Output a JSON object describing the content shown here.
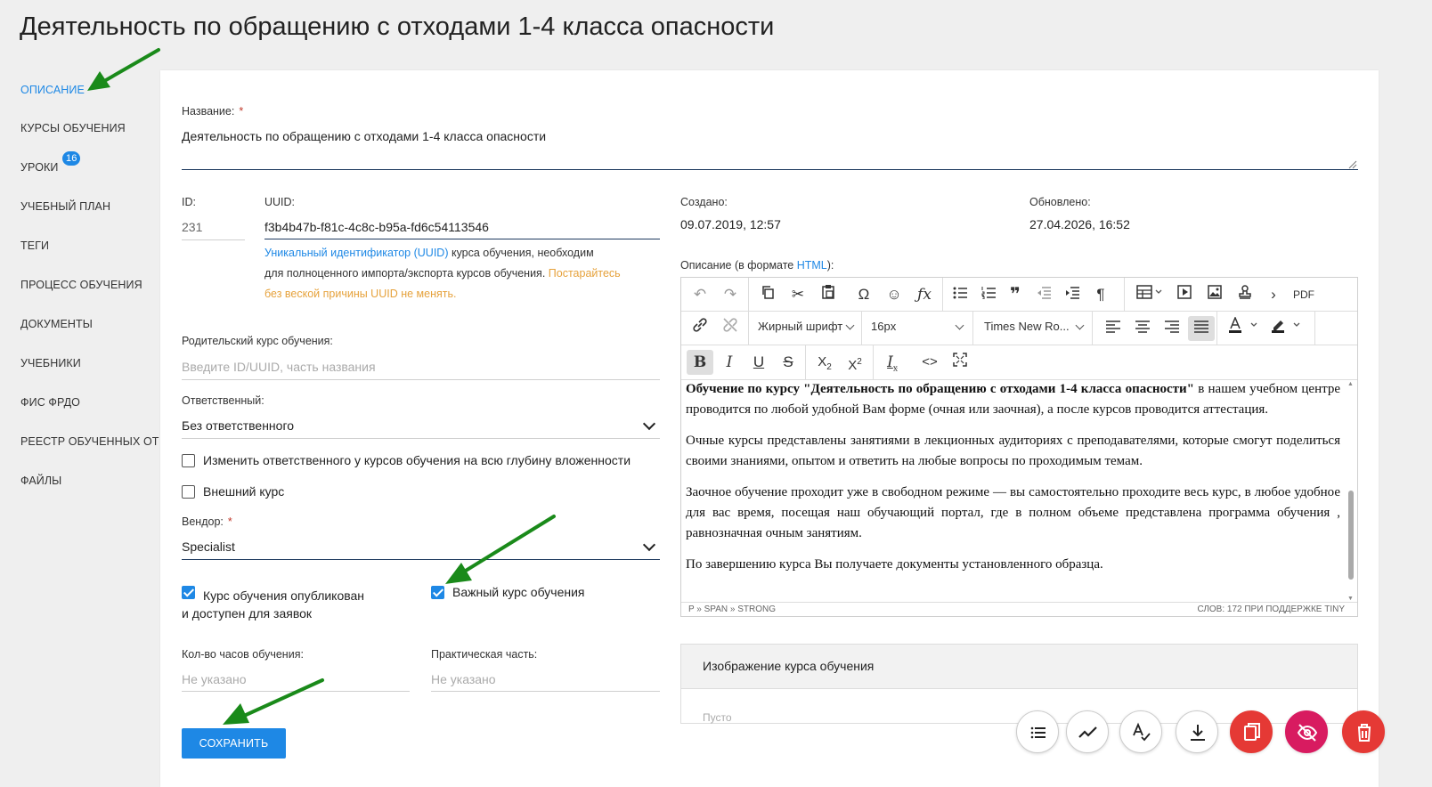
{
  "page": {
    "title": "Деятельность по обращению с отходами 1-4 класса опасности"
  },
  "sidebar": {
    "items": [
      {
        "label": "ОПИСАНИЕ",
        "active": true
      },
      {
        "label": "КУРСЫ ОБУЧЕНИЯ"
      },
      {
        "label": "УРОКИ",
        "badge": "16"
      },
      {
        "label": "УЧЕБНЫЙ ПЛАН"
      },
      {
        "label": "ТЕГИ"
      },
      {
        "label": "ПРОЦЕСС ОБУЧЕНИЯ"
      },
      {
        "label": "ДОКУМЕНТЫ"
      },
      {
        "label": "УЧЕБНИКИ"
      },
      {
        "label": "ФИС ФРДО"
      },
      {
        "label": "РЕЕСТР ОБУЧЕННЫХ ОТ"
      },
      {
        "label": "ФАЙЛЫ"
      }
    ]
  },
  "form": {
    "name": {
      "label": "Название:",
      "required": "*",
      "value": "Деятельность по обращению с отходами 1-4 класса опасности"
    },
    "id": {
      "label": "ID:",
      "value": "231"
    },
    "uuid": {
      "label": "UUID:",
      "value": "f3b4b47b-f81c-4c8c-b95a-fd6c54113546",
      "hint_link": "Уникальный идентификатор (UUID)",
      "hint_text1": " курса обучения, необходим",
      "hint_text2": "для полноценного импорта/экспорта курсов обучения. ",
      "hint_warn1": "Постарайтесь",
      "hint_warn2": "без веской причины UUID не менять."
    },
    "created": {
      "label": "Создано:",
      "value": "09.07.2019, 12:57"
    },
    "updated": {
      "label": "Обновлено:",
      "value": "27.04.2026, 16:52"
    },
    "parent": {
      "label": "Родительский курс обучения:",
      "placeholder": "Введите ID/UUID, часть названия"
    },
    "responsible": {
      "label": "Ответственный:",
      "value": "Без ответственного"
    },
    "change_responsible": {
      "label": "Изменить ответственного у курсов обучения на всю глубину вложенности",
      "checked": false
    },
    "external": {
      "label": "Внешний курс",
      "checked": false
    },
    "vendor": {
      "label": "Вендор:",
      "required": "*",
      "value": "Specialist"
    },
    "published": {
      "label1": "Курс обучения опубликован",
      "label2": "и доступен для заявок",
      "checked": true
    },
    "important": {
      "label": "Важный курс обучения",
      "checked": true
    },
    "hours": {
      "label": "Кол-во часов обучения:",
      "placeholder": "Не указано"
    },
    "practice": {
      "label": "Практическая часть:",
      "placeholder": "Не указано"
    },
    "save": {
      "label": "СОХРАНИТЬ"
    }
  },
  "editor": {
    "label_prefix": "Описание (в формате ",
    "label_link": "HTML",
    "label_suffix": "):",
    "toolbar": {
      "pdf": "PDF",
      "font_weight": "Жирный шрифт",
      "font_size": "16px",
      "font_family": "Times New Ro..."
    },
    "content": {
      "p1_bold": "Обучение по курсу \"Деятельность по обращению с отходами 1-4 класса опасности\"",
      "p1_rest": " в нашем учебном центре проводится по любой удобной Вам форме (очная или заочная), а после курсов проводится аттестация.",
      "p2": "Очные курсы  представлены занятиями в лекционных аудиториях с преподавателями, которые смогут поделиться своими знаниями, опытом и ответить на любые вопросы по проходимым темам.",
      "p3": "Заочное обучение проходит уже в свободном режиме — вы самостоятельно проходите весь курс, в любое удобное для вас время, посещая наш обучающий портал, где в полном объеме представлена программа обучения , равнозначная очным занятиям.",
      "p4": "По завершению курса Вы получаете документы установленного образца."
    },
    "status_path": "P » SPAN » STRONG",
    "status_words": "СЛОВ: 172  ПРИ ПОДДЕРЖКЕ TINY"
  },
  "image_panel": {
    "title": "Изображение курса обучения",
    "empty": "Пусто"
  },
  "colors": {
    "accent": "#1e88e5",
    "danger": "#e53935",
    "pink": "#d81b60",
    "warning": "#e6a23c",
    "annotation_arrow": "#1a8a1a"
  }
}
